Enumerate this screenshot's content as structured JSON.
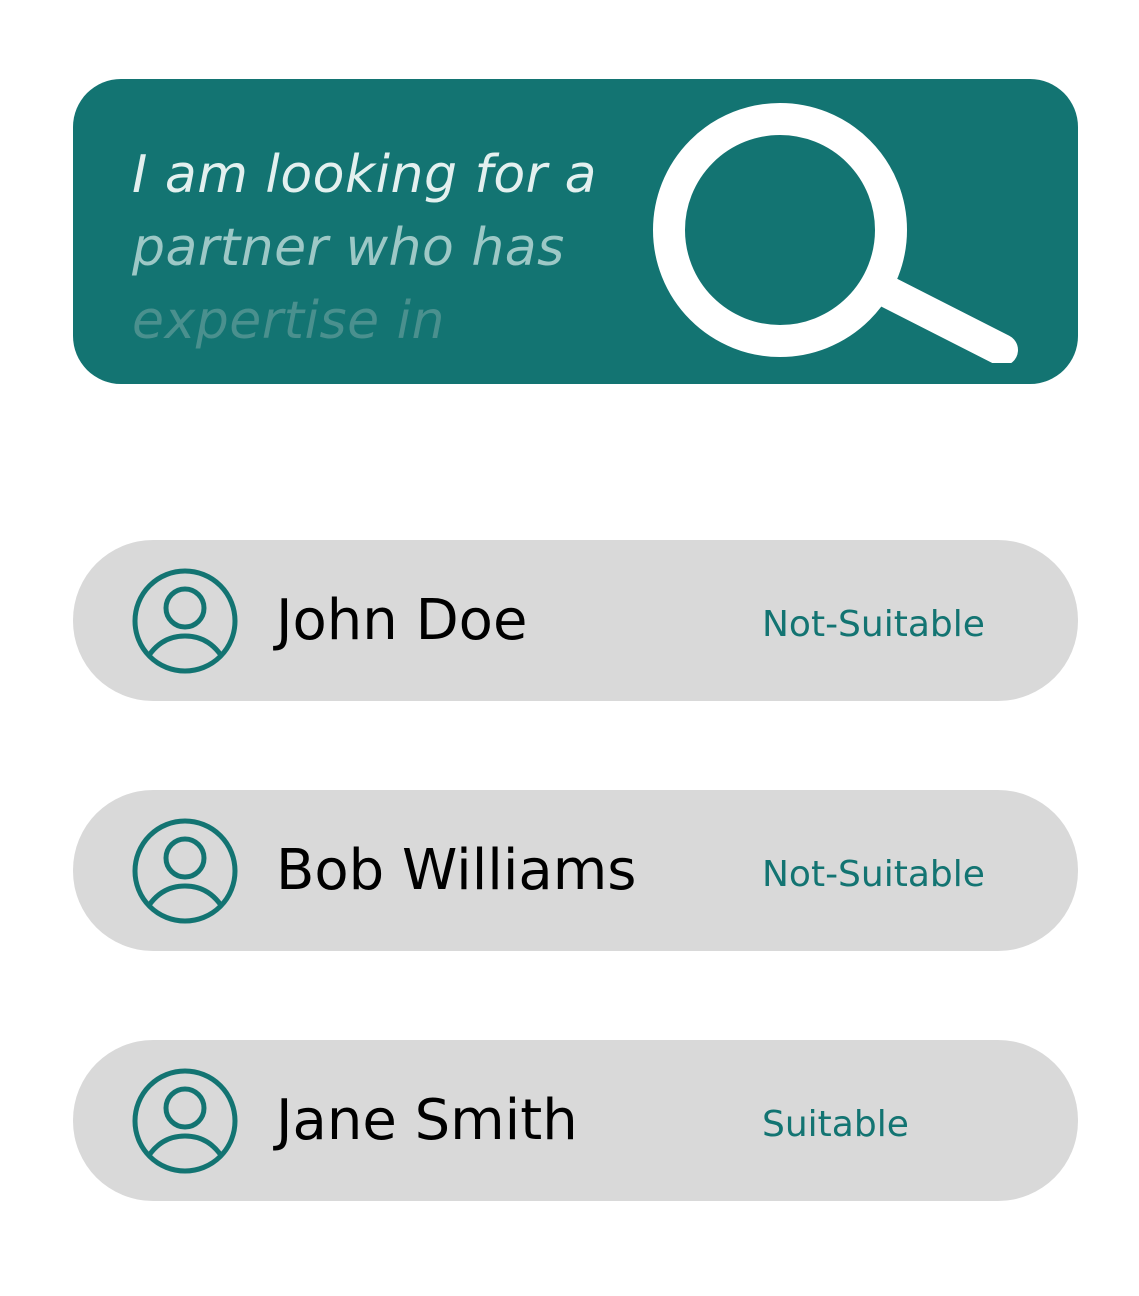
{
  "colors": {
    "accent": "#137472",
    "row_background": "#d9d9d9",
    "page_background": "#ffffff",
    "name_text": "#000000",
    "query_text_lines": [
      "#e3f0ef",
      "#9dc8c6",
      "#4a908e"
    ]
  },
  "search": {
    "query_lines": [
      "I am looking for a",
      "partner who has",
      "expertise in"
    ],
    "icon": "search-icon"
  },
  "results": [
    {
      "avatar_icon": "user-icon",
      "name": "John Doe",
      "status": "Not-Suitable"
    },
    {
      "avatar_icon": "user-icon",
      "name": "Bob Williams",
      "status": "Not-Suitable"
    },
    {
      "avatar_icon": "user-icon",
      "name": "Jane Smith",
      "status": "Suitable"
    }
  ]
}
